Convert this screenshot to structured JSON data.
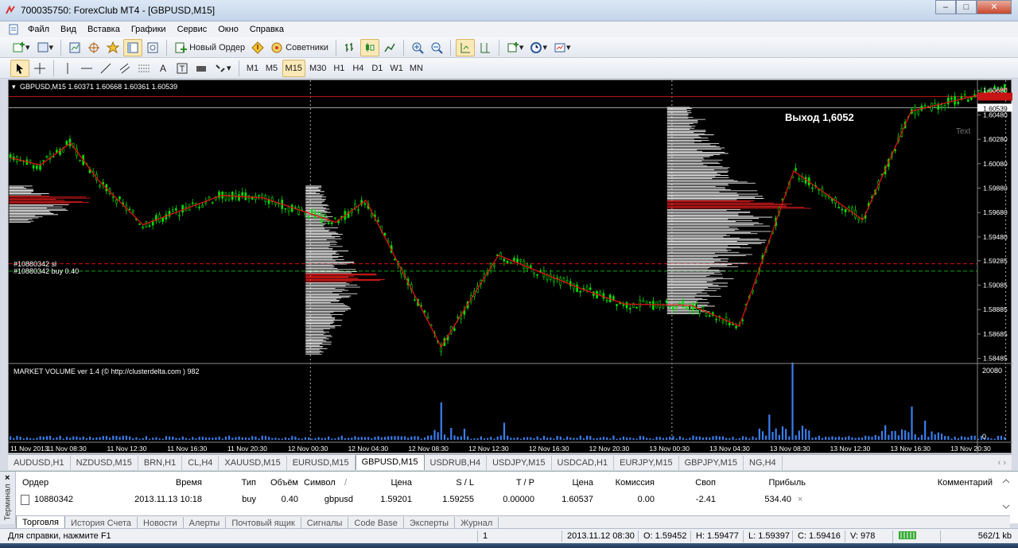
{
  "window": {
    "title": "700035750: ForexClub MT4 - [GBPUSD,M15]",
    "min": "‒",
    "max": "□",
    "close": "✕"
  },
  "menu": [
    "Файл",
    "Вид",
    "Вставка",
    "Графики",
    "Сервис",
    "Окно",
    "Справка"
  ],
  "toolbar": {
    "new_order": "Новый Ордер",
    "advisors": "Советники"
  },
  "timeframes": [
    "M1",
    "M5",
    "M15",
    "M30",
    "H1",
    "H4",
    "D1",
    "W1",
    "MN"
  ],
  "active_timeframe": "M15",
  "chart": {
    "header": "GBPUSD,M15  1.60371 1.60668 1.60361 1.60539",
    "exit_label": "Выход 1,6052",
    "text_label": "Text",
    "order_sl_label": "#10880342 sl",
    "order_buy_label": "#10880342 buy 0.40",
    "current_price": "1.60539",
    "indicator_label": "MARKET VOLUME ver 1.4 (© http://clusterdelta.com ) 982",
    "volume_max": "20080",
    "volume_zero": "0",
    "colors": {
      "candle": "#00e000",
      "zigzag": "#e01010",
      "volume": "#3a7ff0",
      "profile": "#ffffff",
      "profile_highlight": "#ff2020"
    }
  },
  "chart_data": {
    "type": "line",
    "title": "GBPUSD,M15",
    "price_ticks": [
      "1.60680",
      "1.60480",
      "1.60280",
      "1.60080",
      "1.59880",
      "1.59680",
      "1.59480",
      "1.59285",
      "1.59085",
      "1.58885",
      "1.58685",
      "1.58485"
    ],
    "time_ticks": [
      "11 Nov 2013",
      "11 Nov 08:30",
      "11 Nov 12:30",
      "11 Nov 16:30",
      "11 Nov 20:30",
      "12 Nov 00:30",
      "12 Nov 04:30",
      "12 Nov 08:30",
      "12 Nov 12:30",
      "12 Nov 16:30",
      "12 Nov 20:30",
      "13 Nov 00:30",
      "13 Nov 04:30",
      "13 Nov 08:30",
      "13 Nov 12:30",
      "13 Nov 16:30",
      "13 Nov 20:30"
    ],
    "ylim": [
      1.5845,
      1.6075
    ],
    "zigzag": [
      {
        "t": 0,
        "p": 1.6013
      },
      {
        "t": 0.5,
        "p": 1.6007
      },
      {
        "t": 1.0,
        "p": 1.6025
      },
      {
        "t": 1.45,
        "p": 1.5995
      },
      {
        "t": 2.2,
        "p": 1.5958
      },
      {
        "t": 3.5,
        "p": 1.5982
      },
      {
        "t": 4.2,
        "p": 1.598
      },
      {
        "t": 5.4,
        "p": 1.596
      },
      {
        "t": 5.9,
        "p": 1.5978
      },
      {
        "t": 7.15,
        "p": 1.5858
      },
      {
        "t": 8.1,
        "p": 1.5933
      },
      {
        "t": 9.5,
        "p": 1.5905
      },
      {
        "t": 10.2,
        "p": 1.5893
      },
      {
        "t": 11.3,
        "p": 1.5892
      },
      {
        "t": 12.1,
        "p": 1.5875
      },
      {
        "t": 13.0,
        "p": 1.6002
      },
      {
        "t": 14.15,
        "p": 1.5962
      },
      {
        "t": 14.95,
        "p": 1.6051
      },
      {
        "t": 16.55,
        "p": 1.607
      }
    ],
    "volume_peaks": [
      {
        "t": 7.15,
        "v": 10500
      },
      {
        "t": 8.2,
        "v": 4800
      },
      {
        "t": 13.0,
        "v": 20080
      },
      {
        "t": 12.6,
        "v": 6500
      },
      {
        "t": 14.95,
        "v": 8200
      },
      {
        "t": 14.5,
        "v": 3800
      },
      {
        "t": 15.2,
        "v": 5000
      }
    ]
  },
  "symbol_tabs": [
    "AUDUSD,H1",
    "NZDUSD,M15",
    "BRN,H1",
    "CL,H4",
    "XAUUSD,M15",
    "EURUSD,M15",
    "GBPUSD,M15",
    "USDRUB,H4",
    "USDJPY,M15",
    "USDCAD,H1",
    "EURJPY,M15",
    "GBPJPY,M15",
    "NG,H4"
  ],
  "active_symbol_tab": "GBPUSD,M15",
  "terminal": {
    "side_label": "Терминал",
    "headers": {
      "order": "Ордер",
      "time": "Время",
      "type": "Тип",
      "volume": "Объём",
      "symbol": "Символ",
      "sort": "/",
      "price": "Цена",
      "sl": "S / L",
      "tp": "T / P",
      "price2": "Цена",
      "commission": "Комиссия",
      "swap": "Своп",
      "profit": "Прибыль",
      "comment": "Комментарий"
    },
    "row": {
      "order": "10880342",
      "time": "2013.11.13 10:18",
      "type": "buy",
      "volume": "0.40",
      "symbol": "gbpusd",
      "price": "1.59201",
      "sl": "1.59255",
      "tp": "0.00000",
      "price2": "1.60537",
      "commission": "0.00",
      "swap": "-2.41",
      "profit": "534.40",
      "close": "×"
    },
    "tabs": [
      "Торговля",
      "История Счета",
      "Новости",
      "Алерты",
      "Почтовый ящик",
      "Сигналы",
      "Code Base",
      "Эксперты",
      "Журнал"
    ]
  },
  "status": {
    "help": "Для справки, нажмите F1",
    "profile": "1",
    "date": "2013.11.12 08:30",
    "open": "O: 1.59452",
    "high": "H: 1.59477",
    "low": "L: 1.59397",
    "close": "C: 1.59416",
    "vol": "V: 978",
    "traffic": "562/1 kb"
  }
}
